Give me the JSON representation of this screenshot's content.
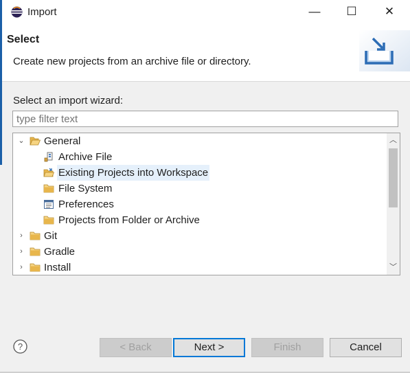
{
  "window": {
    "title": "Import",
    "minimize_glyph": "—",
    "maximize_glyph": "☐",
    "close_glyph": "✕"
  },
  "header": {
    "title": "Select",
    "description": "Create new projects from an archive file or directory."
  },
  "wizard": {
    "label": "Select an import wizard:",
    "filter_placeholder": "type filter text",
    "filter_value": ""
  },
  "tree": {
    "items": [
      {
        "label": "General",
        "level": 0,
        "expanded": true,
        "icon": "folder-open-icon"
      },
      {
        "label": "Archive File",
        "level": 1,
        "icon": "archive-file-icon"
      },
      {
        "label": "Existing Projects into Workspace",
        "level": 1,
        "icon": "existing-projects-icon",
        "selected": true
      },
      {
        "label": "File System",
        "level": 1,
        "icon": "folder-icon"
      },
      {
        "label": "Preferences",
        "level": 1,
        "icon": "preferences-icon"
      },
      {
        "label": "Projects from Folder or Archive",
        "level": 1,
        "icon": "folder-icon"
      },
      {
        "label": "Git",
        "level": 0,
        "expanded": false,
        "icon": "folder-icon"
      },
      {
        "label": "Gradle",
        "level": 0,
        "expanded": false,
        "icon": "folder-icon"
      },
      {
        "label": "Install",
        "level": 0,
        "expanded": false,
        "icon": "folder-icon"
      }
    ]
  },
  "buttons": {
    "back": "< Back",
    "next": "Next >",
    "finish": "Finish",
    "cancel": "Cancel",
    "help": "?"
  },
  "colors": {
    "accent": "#0078d7",
    "selection": "#e5f0fb",
    "folder": "#e8b64c"
  }
}
